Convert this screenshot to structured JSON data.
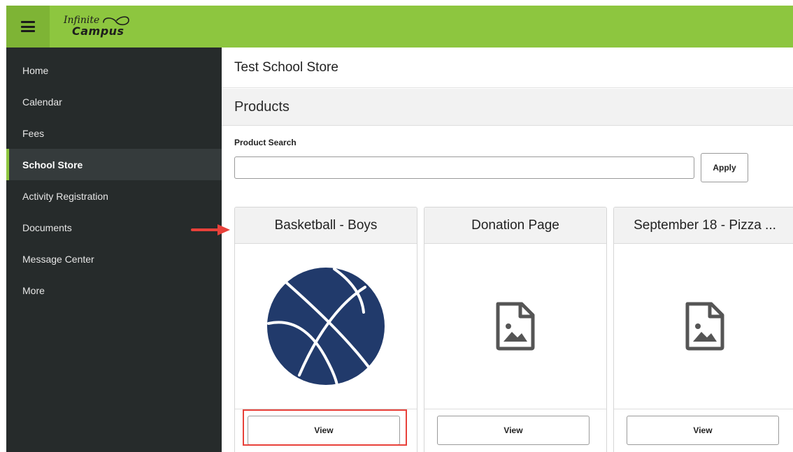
{
  "header": {
    "logo_line1": "Infinite",
    "logo_line2": "Campus"
  },
  "sidebar": {
    "items": [
      {
        "label": "Home"
      },
      {
        "label": "Calendar"
      },
      {
        "label": "Fees"
      },
      {
        "label": "School Store",
        "active": true
      },
      {
        "label": "Activity Registration"
      },
      {
        "label": "Documents"
      },
      {
        "label": "Message Center"
      },
      {
        "label": "More"
      }
    ]
  },
  "main": {
    "store_title": "Test School Store",
    "section_title": "Products",
    "search": {
      "label": "Product Search",
      "value": "",
      "placeholder": "",
      "apply_label": "Apply"
    },
    "products": [
      {
        "name": "Basketball - Boys",
        "image": "basketball-icon",
        "view_label": "View"
      },
      {
        "name": "Donation Page",
        "image": "image-placeholder-icon",
        "view_label": "View"
      },
      {
        "name": "September 18 - Pizza ...",
        "image": "image-placeholder-icon",
        "view_label": "View"
      }
    ]
  },
  "colors": {
    "header_green": "#8dc63f",
    "sidebar_bg": "#262b2b",
    "basketball_navy": "#213a6b",
    "annotation_red": "#e8413a",
    "placeholder_gray": "#555555"
  }
}
